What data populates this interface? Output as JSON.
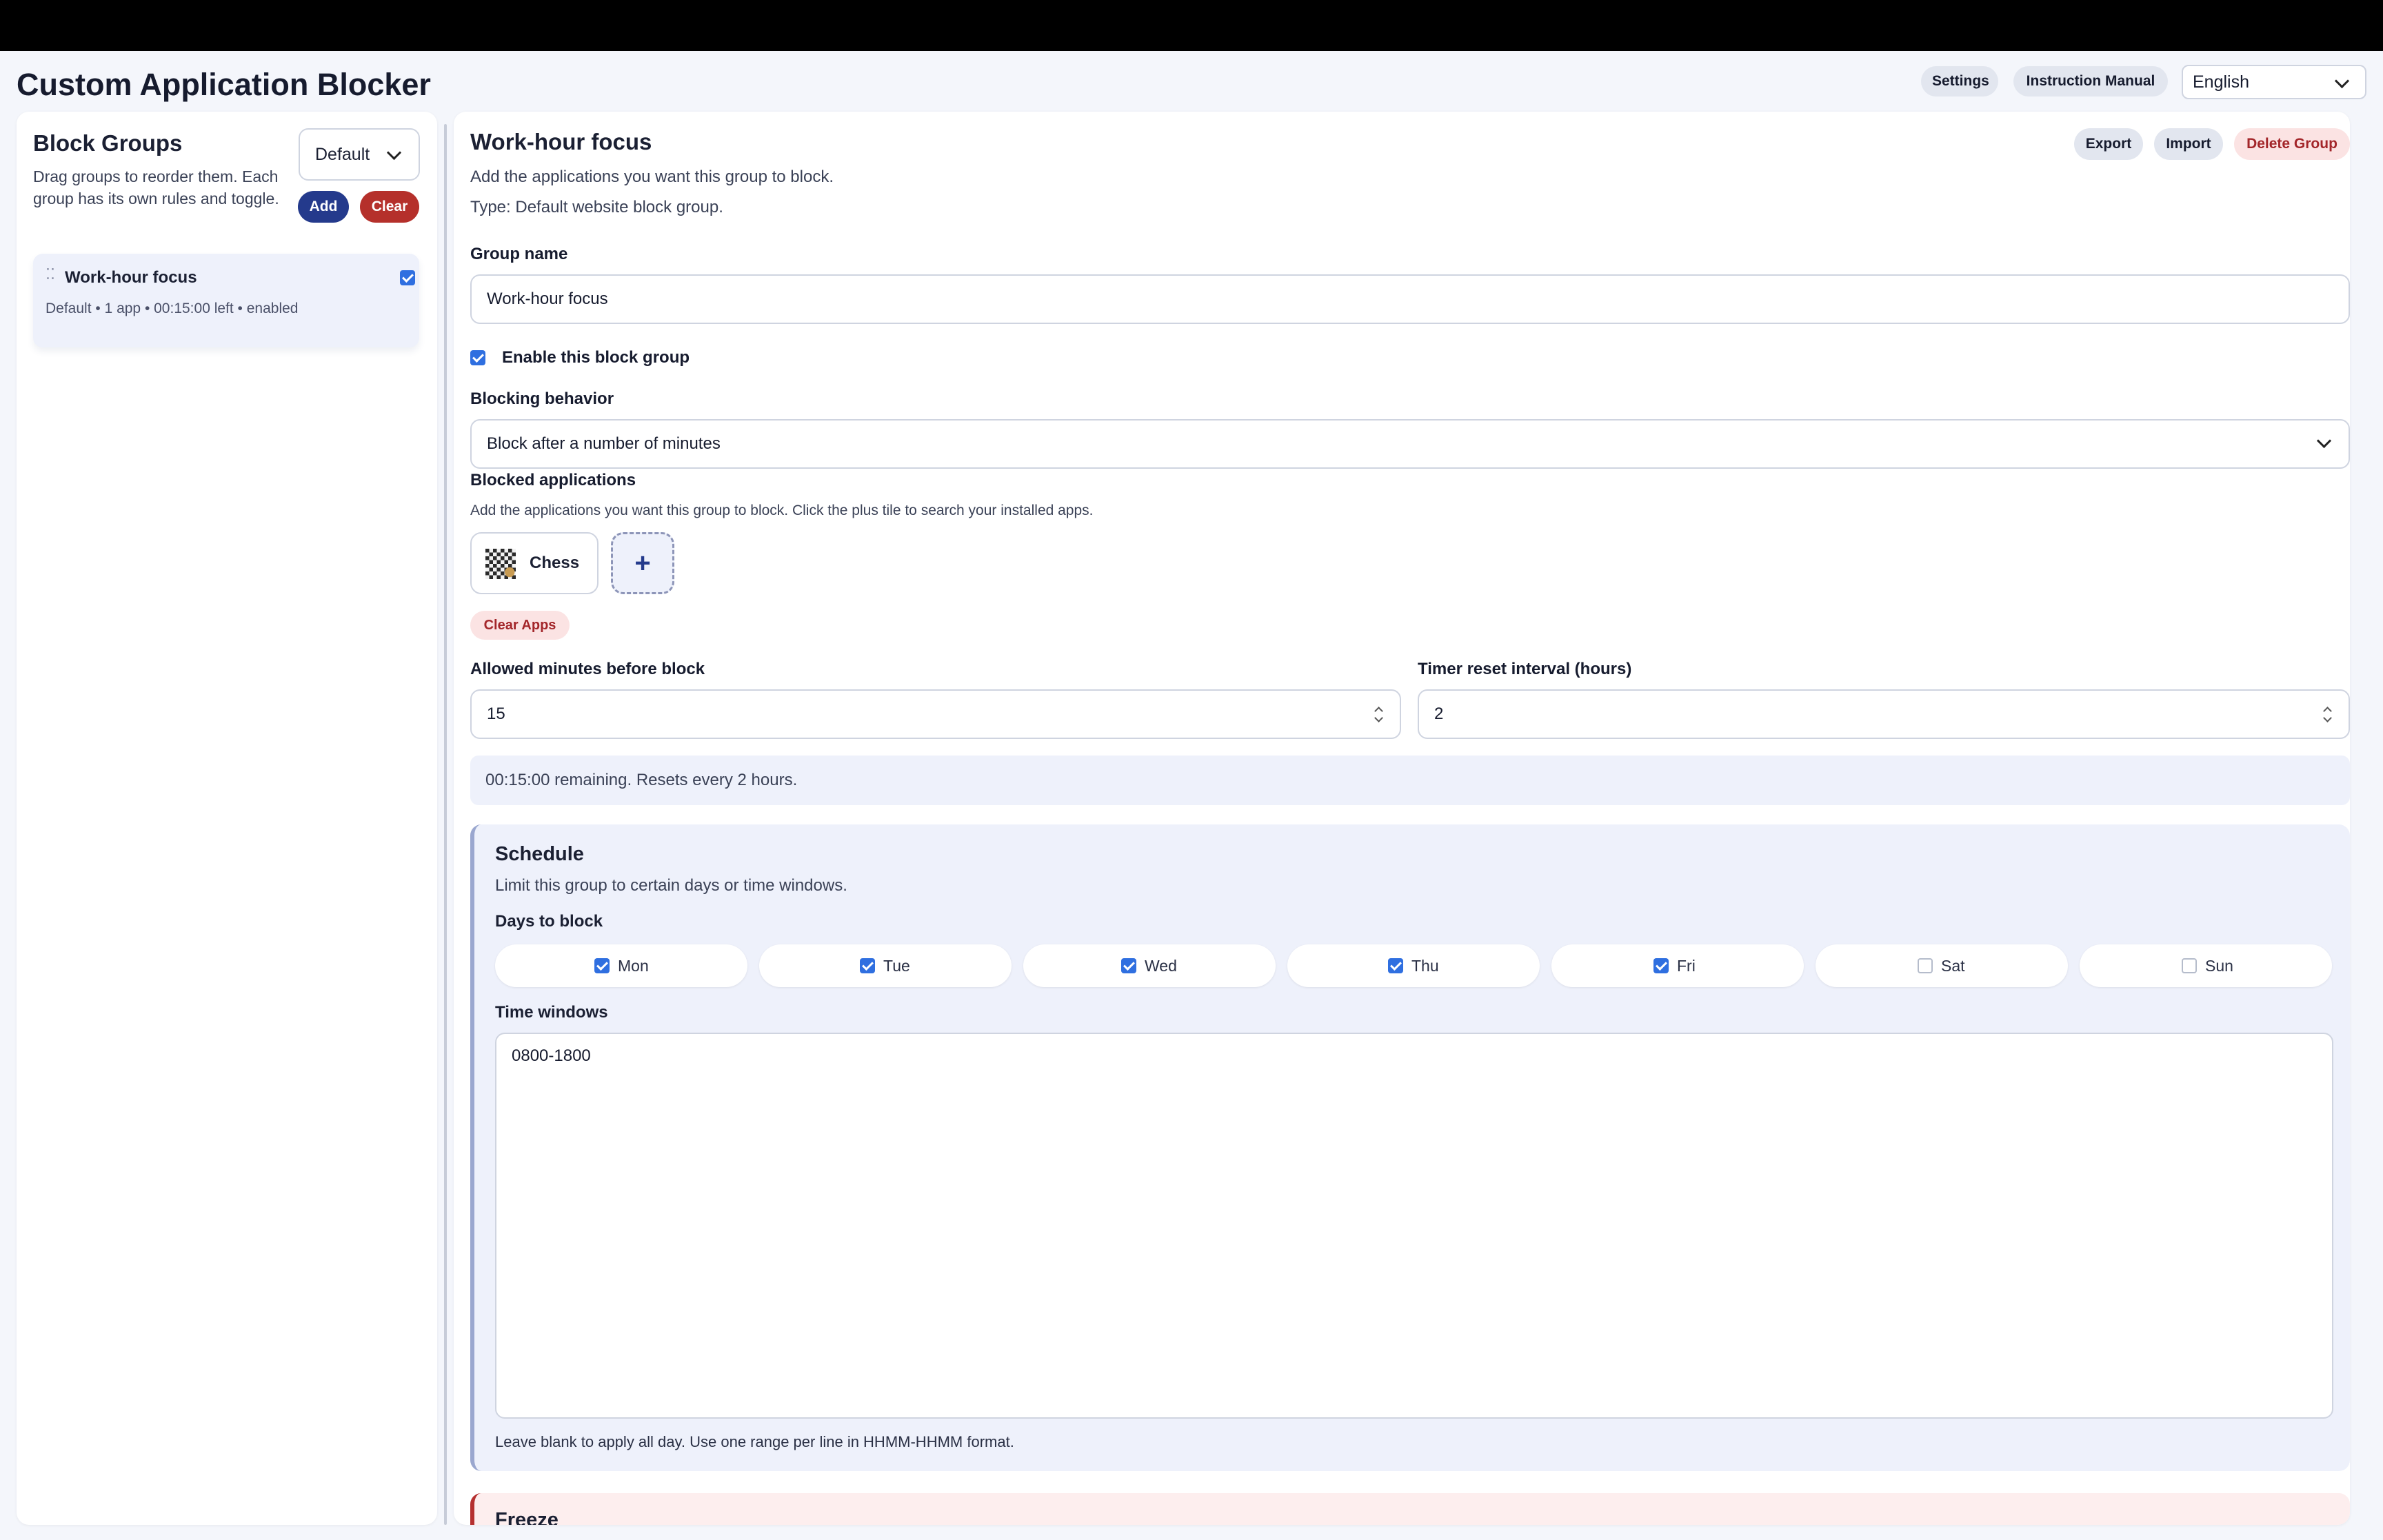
{
  "header": {
    "title": "Custom Application Blocker",
    "settings_label": "Settings",
    "manual_label": "Instruction Manual",
    "language": "English"
  },
  "sidebar": {
    "title": "Block Groups",
    "description": "Drag groups to reorder them. Each group has its own rules and toggle.",
    "type_filter": "Default",
    "add_label": "Add",
    "clear_label": "Clear",
    "groups": [
      {
        "name": "Work-hour focus",
        "meta": "Default • 1 app • 00:15:00 left • enabled",
        "enabled": true
      }
    ]
  },
  "main": {
    "title": "Work-hour focus",
    "subtitle": "Add the applications you want this group to block.",
    "type_text": "Type: Default website block group.",
    "export_label": "Export",
    "import_label": "Import",
    "delete_label": "Delete Group",
    "group_name_label": "Group name",
    "group_name_value": "Work-hour focus",
    "enable_label": "Enable this block group",
    "enable_checked": true,
    "behavior_label": "Blocking behavior",
    "behavior_value": "Block after a number of minutes",
    "apps_label": "Blocked applications",
    "apps_help": "Add the applications you want this group to block. Click the plus tile to search your installed apps.",
    "apps": [
      {
        "name": "Chess",
        "icon": "chess-app-icon"
      }
    ],
    "add_app_icon": "plus-icon",
    "clear_apps_label": "Clear Apps",
    "allowed_minutes_label": "Allowed minutes before block",
    "allowed_minutes_value": "15",
    "reset_interval_label": "Timer reset interval (hours)",
    "reset_interval_value": "2",
    "status_text": "00:15:00 remaining. Resets every 2 hours."
  },
  "schedule": {
    "title": "Schedule",
    "description": "Limit this group to certain days or time windows.",
    "days_label": "Days to block",
    "days": [
      {
        "label": "Mon",
        "checked": true
      },
      {
        "label": "Tue",
        "checked": true
      },
      {
        "label": "Wed",
        "checked": true
      },
      {
        "label": "Thu",
        "checked": true
      },
      {
        "label": "Fri",
        "checked": true
      },
      {
        "label": "Sat",
        "checked": false
      },
      {
        "label": "Sun",
        "checked": false
      }
    ],
    "time_windows_label": "Time windows",
    "time_windows_value": "0800-1800",
    "help": "Leave blank to apply all day. Use one range per line in HHMM-HHMM format."
  },
  "freeze": {
    "title": "Freeze"
  },
  "colors": {
    "accent": "#2f6fe0",
    "add_button": "#243a8c",
    "clear_button": "#b5302b",
    "danger_text": "#a3262a",
    "danger_bg": "#fbe3e3"
  }
}
